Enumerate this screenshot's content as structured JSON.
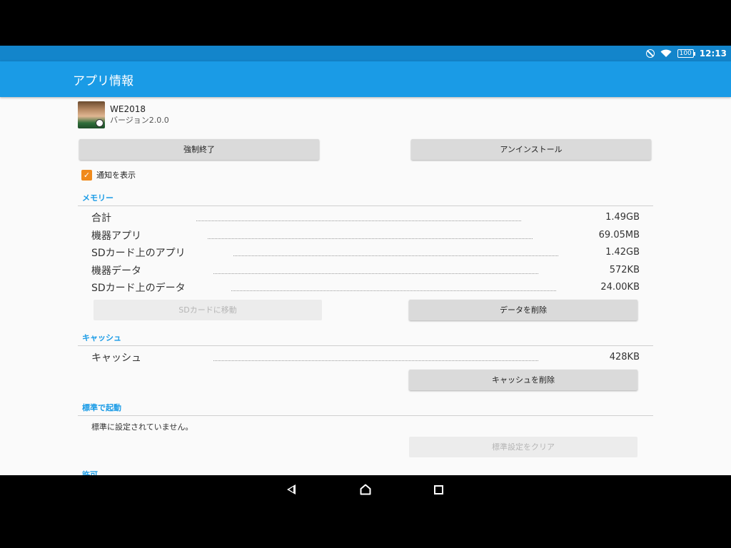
{
  "statusbar": {
    "battery": "100",
    "time": "12:13"
  },
  "appbar": {
    "title": "アプリ情報"
  },
  "app": {
    "name": "WE2018",
    "version": "バージョン2.0.0"
  },
  "actions": {
    "force_stop": "強制終了",
    "uninstall": "アンインストール"
  },
  "notification": {
    "label": "通知を表示",
    "checked": true
  },
  "memory": {
    "header": "メモリー",
    "rows": [
      {
        "label": "合計",
        "value": "1.49GB"
      },
      {
        "label": "機器アプリ",
        "value": "69.05MB"
      },
      {
        "label": "SDカード上のアプリ",
        "value": "1.42GB"
      },
      {
        "label": "機器データ",
        "value": "572KB"
      },
      {
        "label": "SDカード上のデータ",
        "value": "24.00KB"
      }
    ],
    "move_to_sd": "SDカードに移動",
    "clear_data": "データを削除"
  },
  "cache": {
    "header": "キャッシュ",
    "label": "キャッシュ",
    "value": "428KB",
    "clear_cache": "キャッシュを削除"
  },
  "launch_default": {
    "header": "標準で起動",
    "text": "標準に設定されていません。",
    "clear_defaults": "標準設定をクリア"
  },
  "permissions": {
    "header": "許可"
  }
}
